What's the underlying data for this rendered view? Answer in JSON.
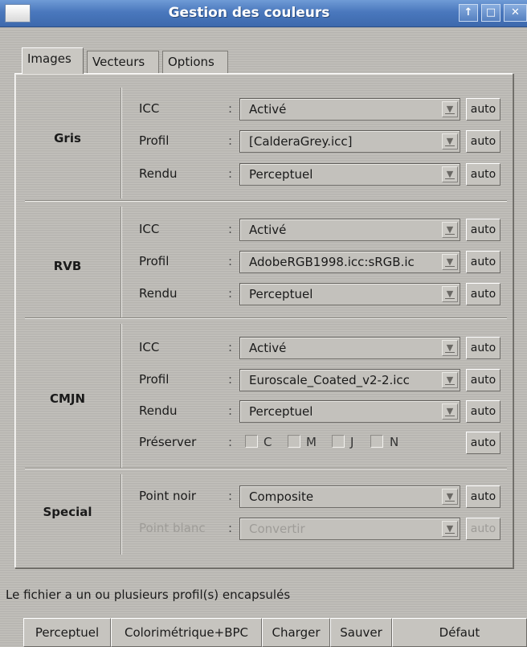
{
  "window": {
    "title": "Gestion des couleurs"
  },
  "tabs": [
    {
      "label": "Images"
    },
    {
      "label": "Vecteurs"
    },
    {
      "label": "Options"
    }
  ],
  "sections": {
    "gris": {
      "label": "Gris",
      "rows": [
        {
          "label": "ICC",
          "value": "Activé",
          "auto": "auto"
        },
        {
          "label": "Profil",
          "value": "[CalderaGrey.icc]",
          "auto": "auto"
        },
        {
          "label": "Rendu",
          "value": "Perceptuel",
          "auto": "auto"
        }
      ]
    },
    "rvb": {
      "label": "RVB",
      "rows": [
        {
          "label": "ICC",
          "value": "Activé",
          "auto": "auto"
        },
        {
          "label": "Profil",
          "value": "AdobeRGB1998.icc:sRGB.ic",
          "auto": "auto"
        },
        {
          "label": "Rendu",
          "value": "Perceptuel",
          "auto": "auto"
        }
      ]
    },
    "cmjn": {
      "label": "CMJN",
      "rows": [
        {
          "label": "ICC",
          "value": "Activé",
          "auto": "auto"
        },
        {
          "label": "Profil",
          "value": "Euroscale_Coated_v2-2.icc",
          "auto": "auto"
        },
        {
          "label": "Rendu",
          "value": "Perceptuel",
          "auto": "auto"
        }
      ],
      "preserve": {
        "label": "Préserver",
        "checks": [
          "C",
          "M",
          "J",
          "N"
        ],
        "auto": "auto"
      }
    },
    "special": {
      "label": "Special",
      "rows": [
        {
          "label": "Point noir",
          "value": "Composite",
          "auto": "auto"
        },
        {
          "label": "Point blanc",
          "value": "Convertir",
          "auto": "auto"
        }
      ]
    }
  },
  "colon": ":",
  "status": "Le fichier a un ou plusieurs profil(s) encapsulés",
  "buttons": {
    "perceptuel": "Perceptuel",
    "colorimetrique": "Colorimétrique+BPC",
    "charger": "Charger",
    "sauver": "Sauver",
    "defaut": "Défaut"
  },
  "colors": {
    "titlebar": "#4a78bd",
    "background": "#bdbbb6"
  }
}
